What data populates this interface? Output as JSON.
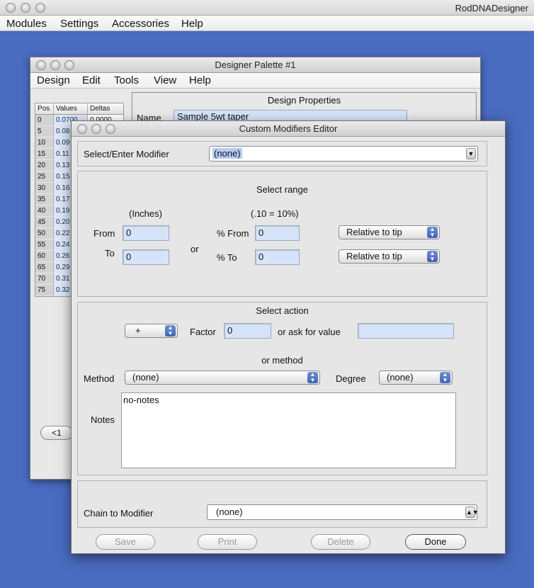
{
  "app": {
    "title": "RodDNADesigner",
    "menu": [
      "Modules",
      "Settings",
      "Accessories",
      "Help"
    ]
  },
  "palette": {
    "title": "Designer Palette #1",
    "menu": [
      "Design",
      "Edit",
      "Tools",
      "View",
      "Help"
    ],
    "table": {
      "headers": [
        "Pos",
        "Values",
        "Deltas"
      ],
      "rows": [
        {
          "pos": "0",
          "value": "0.0700",
          "delta": "0.0000"
        },
        {
          "pos": "5",
          "value": "0.08",
          "delta": ""
        },
        {
          "pos": "10",
          "value": "0.09",
          "delta": ""
        },
        {
          "pos": "15",
          "value": "0.11",
          "delta": ""
        },
        {
          "pos": "20",
          "value": "0.13",
          "delta": ""
        },
        {
          "pos": "25",
          "value": "0.15",
          "delta": ""
        },
        {
          "pos": "30",
          "value": "0.16",
          "delta": ""
        },
        {
          "pos": "35",
          "value": "0.17",
          "delta": ""
        },
        {
          "pos": "40",
          "value": "0.19",
          "delta": ""
        },
        {
          "pos": "45",
          "value": "0.20",
          "delta": ""
        },
        {
          "pos": "50",
          "value": "0.22",
          "delta": ""
        },
        {
          "pos": "55",
          "value": "0.24",
          "delta": ""
        },
        {
          "pos": "60",
          "value": "0.26",
          "delta": ""
        },
        {
          "pos": "65",
          "value": "0.29",
          "delta": ""
        },
        {
          "pos": "70",
          "value": "0.31",
          "delta": ""
        },
        {
          "pos": "75",
          "value": "0.32",
          "delta": ""
        }
      ]
    },
    "nav_prev": "<1",
    "design_properties": {
      "header": "Design Properties",
      "name_label": "Name",
      "name_value": "Sample 5wt taper"
    }
  },
  "editor": {
    "title": "Custom Modifiers Editor",
    "select_label": "Select/Enter Modifier",
    "select_value": "(none)",
    "range": {
      "header": "Select range",
      "inches_label": "(Inches)",
      "percent_hint": "(.10 = 10%)",
      "from_label": "From",
      "to_label": "To",
      "or_label": "or",
      "from_value": "0",
      "to_value": "0",
      "pct_from_label": "% From",
      "pct_to_label": "% To",
      "pct_from_value": "0",
      "pct_to_value": "0",
      "relative_from": "Relative to tip",
      "relative_to": "Relative to tip"
    },
    "action": {
      "header": "Select action",
      "operator": "+",
      "factor_label": "Factor",
      "factor_value": "0",
      "ask_label": "or ask for value",
      "ask_value": "",
      "or_method": "or method",
      "method_label": "Method",
      "method_value": "(none)",
      "degree_label": "Degree",
      "degree_value": "(none)",
      "notes_label": "Notes",
      "notes_value": "no-notes"
    },
    "chain": {
      "label": "Chain to Modifier",
      "value": "(none)"
    },
    "buttons": {
      "save": "Save",
      "print": "Print",
      "delete": "Delete",
      "done": "Done"
    }
  }
}
